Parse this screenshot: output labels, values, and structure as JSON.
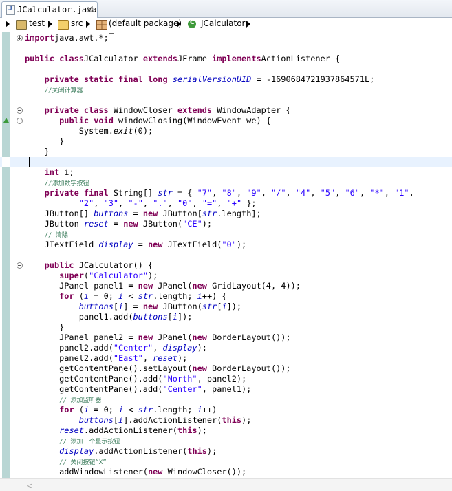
{
  "tab": {
    "title": "JCalculator.java",
    "close_glyph": "☒"
  },
  "breadcrumb": {
    "items": [
      "test",
      "src",
      "(default package)",
      "JCalculator"
    ]
  },
  "code_lines": [
    [
      [
        "kw",
        "import"
      ],
      [
        "",
        "java.awt.*;"
      ]
    ],
    [],
    [
      [
        "kw",
        "public class"
      ],
      [
        "",
        "JCalculator "
      ],
      [
        "kw",
        "extends"
      ],
      [
        "",
        "JFrame "
      ],
      [
        "kw",
        "implements"
      ],
      [
        "",
        "ActionListener {"
      ]
    ],
    [],
    [
      [
        "",
        "    "
      ],
      [
        "kw",
        "private static final long"
      ],
      [
        "fld",
        " serialVersionUID"
      ],
      [
        "",
        ""
      ],
      [
        "",
        "",
        " "
      ],
      [
        "",
        "= -1690684721937864571L;"
      ]
    ],
    [
      [
        "",
        "    "
      ],
      [
        "cm",
        "//关闭计算器"
      ]
    ],
    [],
    [
      [
        "",
        "    "
      ],
      [
        "kw",
        "private class"
      ],
      [
        "",
        "",
        " WindowCloser "
      ],
      [
        "kw",
        "extends"
      ],
      [
        "",
        "",
        " WindowAdapter {"
      ]
    ],
    [
      [
        "",
        "       "
      ],
      [
        "kw",
        "public void"
      ],
      [
        "",
        "",
        " windowClosing(WindowEvent we) {"
      ]
    ],
    [
      [
        "",
        "           System."
      ],
      [
        "it",
        "exit"
      ],
      [
        "",
        "(0);"
      ]
    ],
    [
      [
        "",
        "       }"
      ]
    ],
    [
      [
        "",
        "    }"
      ]
    ],
    [],
    [
      [
        "",
        "    "
      ],
      [
        "kw",
        "int"
      ],
      [
        "",
        "",
        " i;"
      ]
    ],
    [
      [
        "",
        "    "
      ],
      [
        "cm",
        "//添加数字按钮"
      ]
    ],
    [
      [
        "",
        "    "
      ],
      [
        "kw",
        "private final"
      ],
      [
        "",
        "",
        " String[] "
      ],
      [
        "fld",
        "str"
      ],
      [
        "",
        "",
        " = { "
      ],
      [
        "str",
        "\"7\""
      ],
      [
        "",
        ", "
      ],
      [
        "str",
        "\"8\""
      ],
      [
        "",
        ", "
      ],
      [
        "str",
        "\"9\""
      ],
      [
        "",
        ", "
      ],
      [
        "str",
        "\"/\""
      ],
      [
        "",
        ", "
      ],
      [
        "str",
        "\"4\""
      ],
      [
        "",
        ", "
      ],
      [
        "str",
        "\"5\""
      ],
      [
        "",
        ", "
      ],
      [
        "str",
        "\"6\""
      ],
      [
        "",
        ", "
      ],
      [
        "str",
        "\"*\""
      ],
      [
        "",
        ", "
      ],
      [
        "str",
        "\"1\""
      ],
      [
        "",
        ","
      ]
    ],
    [
      [
        "",
        "           "
      ],
      [
        "str",
        "\"2\""
      ],
      [
        "",
        ", "
      ],
      [
        "str",
        "\"3\""
      ],
      [
        "",
        ", "
      ],
      [
        "str",
        "\"-\""
      ],
      [
        "",
        ", "
      ],
      [
        "str",
        "\".\""
      ],
      [
        "",
        ", "
      ],
      [
        "str",
        "\"0\""
      ],
      [
        "",
        ", "
      ],
      [
        "str",
        "\"=\""
      ],
      [
        "",
        ", "
      ],
      [
        "str",
        "\"+\""
      ],
      [
        "",
        "",
        " };"
      ]
    ],
    [
      [
        "",
        "    JButton[] "
      ],
      [
        "fld",
        "buttons"
      ],
      [
        "",
        "",
        " = "
      ],
      [
        "kw",
        "new"
      ],
      [
        "",
        "",
        " JButton["
      ],
      [
        "fld",
        "str"
      ],
      [
        "",
        ".length];"
      ]
    ],
    [
      [
        "",
        "    JButton "
      ],
      [
        "fld",
        "reset"
      ],
      [
        "",
        "",
        " = "
      ],
      [
        "kw",
        "new"
      ],
      [
        "",
        "",
        " JButton("
      ],
      [
        "str",
        "\"CE\""
      ],
      [
        "",
        ");"
      ]
    ],
    [
      [
        "",
        "    "
      ],
      [
        "cm",
        "// 清除"
      ]
    ],
    [
      [
        "",
        "    JTextField "
      ],
      [
        "fld",
        "display"
      ],
      [
        "",
        "",
        " = "
      ],
      [
        "kw",
        "new"
      ],
      [
        "",
        "",
        " JTextField("
      ],
      [
        "str",
        "\"0\""
      ],
      [
        "",
        ");"
      ]
    ],
    [],
    [
      [
        "",
        "    "
      ],
      [
        "kw",
        "public"
      ],
      [
        "",
        "",
        " JCalculator() {"
      ]
    ],
    [
      [
        "",
        "       "
      ],
      [
        "kw",
        "super"
      ],
      [
        "",
        "("
      ],
      [
        "str",
        "\"Calculator\""
      ],
      [
        "",
        ");"
      ]
    ],
    [
      [
        "",
        "       JPanel panel1 = "
      ],
      [
        "kw",
        "new"
      ],
      [
        "",
        "",
        " JPanel("
      ],
      [
        "kw",
        "new"
      ],
      [
        "",
        "",
        " GridLayout(4, 4));"
      ]
    ],
    [
      [
        "",
        "       "
      ],
      [
        "kw",
        "for"
      ],
      [
        "",
        "",
        " ("
      ],
      [
        "fld",
        "i"
      ],
      [
        "",
        "",
        " = 0; "
      ],
      [
        "fld",
        "i"
      ],
      [
        "",
        "",
        " < "
      ],
      [
        "fld",
        "str"
      ],
      [
        "",
        ".length; "
      ],
      [
        "fld",
        "i"
      ],
      [
        "",
        "++) {"
      ]
    ],
    [
      [
        "",
        "           "
      ],
      [
        "fld",
        "buttons"
      ],
      [
        "",
        "["
      ],
      [
        "fld",
        "i"
      ],
      [
        "",
        "] = "
      ],
      [
        "kw",
        "new"
      ],
      [
        "",
        "",
        " JButton("
      ],
      [
        "fld",
        "str"
      ],
      [
        "",
        "["
      ],
      [
        "fld",
        "i"
      ],
      [
        "",
        "]);"
      ]
    ],
    [
      [
        "",
        "           panel1.add("
      ],
      [
        "fld",
        "buttons"
      ],
      [
        "",
        "["
      ],
      [
        "fld",
        "i"
      ],
      [
        "",
        "]);"
      ]
    ],
    [
      [
        "",
        "       }"
      ]
    ],
    [
      [
        "",
        "       JPanel panel2 = "
      ],
      [
        "kw",
        "new"
      ],
      [
        "",
        "",
        " JPanel("
      ],
      [
        "kw",
        "new"
      ],
      [
        "",
        "",
        " BorderLayout());"
      ]
    ],
    [
      [
        "",
        "       panel2.add("
      ],
      [
        "str",
        "\"Center\""
      ],
      [
        "",
        ", "
      ],
      [
        "fld",
        "display"
      ],
      [
        "",
        ");"
      ]
    ],
    [
      [
        "",
        "       panel2.add("
      ],
      [
        "str",
        "\"East\""
      ],
      [
        "",
        ", "
      ],
      [
        "fld",
        "reset"
      ],
      [
        "",
        ");"
      ]
    ],
    [
      [
        "",
        "       getContentPane().setLayout("
      ],
      [
        "kw",
        "new"
      ],
      [
        "",
        "",
        " BorderLayout());"
      ]
    ],
    [
      [
        "",
        "       getContentPane().add("
      ],
      [
        "str",
        "\"North\""
      ],
      [
        "",
        ", panel2);"
      ]
    ],
    [
      [
        "",
        "       getContentPane().add("
      ],
      [
        "str",
        "\"Center\""
      ],
      [
        "",
        ", panel1);"
      ]
    ],
    [
      [
        "",
        "       "
      ],
      [
        "cm",
        "// 添加监听器"
      ]
    ],
    [
      [
        "",
        "       "
      ],
      [
        "kw",
        "for"
      ],
      [
        "",
        "",
        " ("
      ],
      [
        "fld",
        "i"
      ],
      [
        "",
        "",
        " = 0; "
      ],
      [
        "fld",
        "i"
      ],
      [
        "",
        "",
        " < "
      ],
      [
        "fld",
        "str"
      ],
      [
        "",
        ".length; "
      ],
      [
        "fld",
        "i"
      ],
      [
        "",
        "++)"
      ]
    ],
    [
      [
        "",
        "           "
      ],
      [
        "fld",
        "buttons"
      ],
      [
        "",
        "["
      ],
      [
        "fld",
        "i"
      ],
      [
        "",
        "].addActionListener("
      ],
      [
        "kw",
        "this"
      ],
      [
        "",
        ");"
      ]
    ],
    [
      [
        "",
        "       "
      ],
      [
        "fld",
        "reset"
      ],
      [
        "",
        ".addActionListener("
      ],
      [
        "kw",
        "this"
      ],
      [
        "",
        ");"
      ]
    ],
    [
      [
        "",
        "       "
      ],
      [
        "cm",
        "// 添加一个显示按钮"
      ]
    ],
    [
      [
        "",
        "       "
      ],
      [
        "fld",
        "display"
      ],
      [
        "",
        ".addActionListener("
      ],
      [
        "kw",
        "this"
      ],
      [
        "",
        ");"
      ]
    ],
    [
      [
        "",
        "       "
      ],
      [
        "cm",
        "// 关闭按钮“X”"
      ]
    ],
    [
      [
        "",
        "       addWindowListener("
      ],
      [
        "kw",
        "new"
      ],
      [
        "",
        "",
        " WindowCloser());"
      ]
    ]
  ]
}
